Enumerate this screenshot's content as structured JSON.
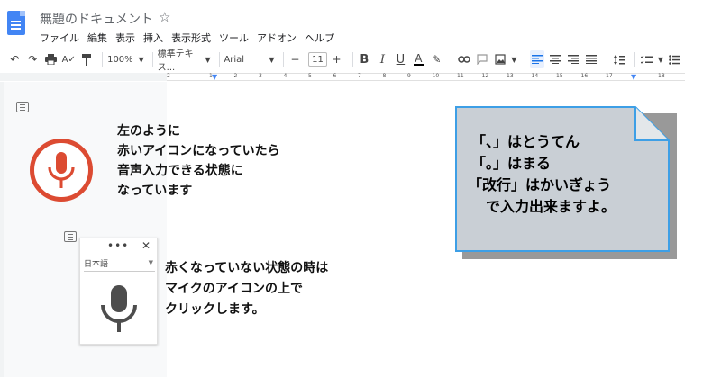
{
  "window": {
    "title": "無題のドキュメント",
    "star": "☆"
  },
  "menu": [
    "ファイル",
    "編集",
    "表示",
    "挿入",
    "表示形式",
    "ツール",
    "アドオン",
    "ヘルプ"
  ],
  "toolbar": {
    "zoom": "100%",
    "style": "標準テキス...",
    "font": "Arial",
    "font_size": "11",
    "minus": "−",
    "plus": "+",
    "bold": "B",
    "italic": "I",
    "underline": "U",
    "text_color": "A"
  },
  "ruler": {
    "left_label": "2",
    "right_label": "18",
    "ticks": [
      "1",
      "2",
      "3",
      "4",
      "5",
      "6",
      "7",
      "8",
      "9",
      "10",
      "11",
      "12",
      "13",
      "14",
      "15",
      "16",
      "17"
    ]
  },
  "voice_panel": {
    "menu": "•••",
    "close": "✕",
    "language": "日本語"
  },
  "notes": {
    "red_mic": [
      "左のように",
      "赤いアイコンになっていたら",
      "音声入力できる状態に",
      "なっています"
    ],
    "gray_mic": [
      "赤くなっていない状態の時は",
      "マイクのアイコンの上で",
      "クリックします。"
    ]
  },
  "callout": [
    "「、」はとうてん",
    "「。」はまる",
    "「改行」はかいぎょう",
    "で入力出来ますよ。"
  ],
  "colors": {
    "accent": "#4285f4",
    "mic_red": "#dc4b32",
    "callout_fill": "#c9cfd5",
    "callout_border": "#3d9fe6"
  }
}
